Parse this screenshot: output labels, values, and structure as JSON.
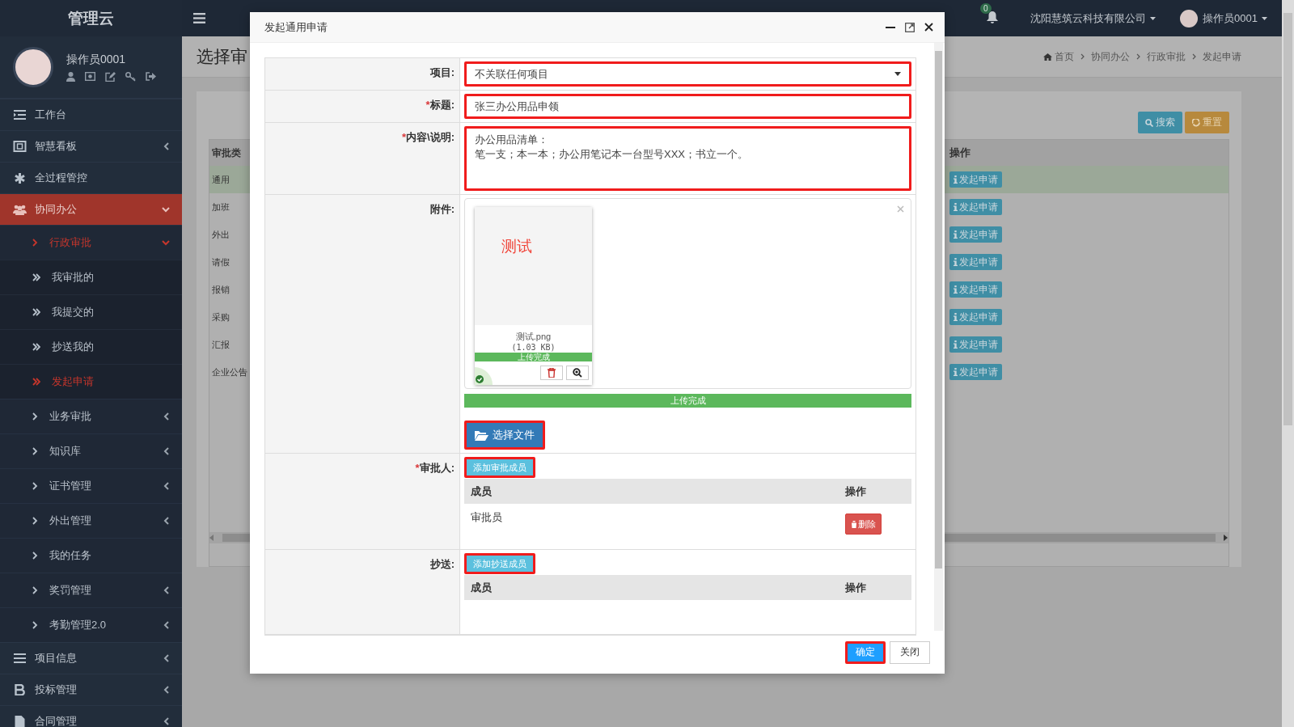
{
  "sidebar": {
    "brand": "管理云",
    "user": {
      "name": "操作员0001"
    },
    "menu": [
      {
        "label": "工作台",
        "selected": false
      },
      {
        "label": "智慧看板",
        "expanded": false,
        "selected": false
      },
      {
        "label": "全过程管控",
        "selected": false
      },
      {
        "label": "协同办公",
        "expanded": true,
        "selected": true,
        "children": [
          {
            "label": "行政审批",
            "expanded": true,
            "selected": true,
            "children": [
              {
                "label": "我审批的",
                "selected": false
              },
              {
                "label": "我提交的",
                "selected": false
              },
              {
                "label": "抄送我的",
                "selected": false
              },
              {
                "label": "发起申请",
                "selected": true
              }
            ]
          },
          {
            "label": "业务审批",
            "expanded": false,
            "selected": false
          },
          {
            "label": "知识库",
            "expanded": false,
            "selected": false
          },
          {
            "label": "证书管理",
            "expanded": false,
            "selected": false
          },
          {
            "label": "外出管理",
            "expanded": false,
            "selected": false
          },
          {
            "label": "我的任务",
            "selected": false
          },
          {
            "label": "奖罚管理",
            "expanded": false,
            "selected": false
          },
          {
            "label": "考勤管理2.0",
            "expanded": false,
            "selected": false
          }
        ]
      },
      {
        "label": "项目信息",
        "expanded": false,
        "selected": false
      },
      {
        "label": "投标管理",
        "expanded": false,
        "selected": false
      },
      {
        "label": "合同管理",
        "expanded": false,
        "selected": false
      }
    ]
  },
  "header": {
    "notification_count": "0",
    "company": "沈阳慧筑云科技有限公司",
    "user": "操作员0001"
  },
  "page": {
    "title": "选择审",
    "breadcrumb": [
      "首页",
      "协同办公",
      "行政审批",
      "发起申请"
    ],
    "buttons": [
      {
        "label": "搜索",
        "kind": "search"
      },
      {
        "label": "重置",
        "kind": "reset"
      }
    ],
    "table": {
      "columns": [
        "审批类",
        "操作"
      ],
      "rows": [
        {
          "type": "通用",
          "action": "发起申请",
          "selected": true
        },
        {
          "type": "加班",
          "action": "发起申请",
          "selected": false
        },
        {
          "type": "外出",
          "action": "发起申请",
          "selected": false
        },
        {
          "type": "请假",
          "action": "发起申请",
          "selected": false
        },
        {
          "type": "报销",
          "action": "发起申请",
          "selected": false
        },
        {
          "type": "采购",
          "action": "发起申请",
          "selected": false
        },
        {
          "type": "汇报",
          "action": "发起申请",
          "selected": false
        },
        {
          "type": "企业公告",
          "action": "发起申请",
          "selected": false
        }
      ]
    }
  },
  "dialog": {
    "title": "发起通用申请",
    "fields": [
      {
        "kind": "select",
        "label": "项目:",
        "value": "不关联任何项目",
        "highlighted": true
      },
      {
        "kind": "input",
        "label": "标题:",
        "required_mark": "*",
        "value": "张三办公用品申领",
        "highlighted": true
      },
      {
        "kind": "textarea",
        "label": "内容\\说明:",
        "required_mark": "*",
        "lines": [
          "办公用品清单：",
          "笔一支；本一本；办公用笔记本一台型号XXX；书立一个。"
        ],
        "highlighted": true
      },
      {
        "kind": "upload",
        "label": "附件:",
        "files": [
          {
            "preview": "测试",
            "name": "测试.png",
            "size": "(1.03 KB)",
            "progress_text": "上传完成",
            "level": 1
          }
        ],
        "progress_text": "上传完成",
        "level": 1,
        "button": {
          "label": "选择文件",
          "highlighted": true
        }
      },
      {
        "kind": "members",
        "label": "审批人:",
        "required_mark": "*",
        "button": {
          "label": "添加审批成员",
          "highlighted": true
        },
        "columns": [
          "成员",
          "操作"
        ],
        "rows": [
          {
            "member": "审批员",
            "action": "删除"
          }
        ]
      },
      {
        "kind": "members",
        "label": "抄送:",
        "button": {
          "label": "添加抄送成员",
          "highlighted": true
        },
        "columns": [
          "成员",
          "操作"
        ]
      }
    ],
    "buttons": [
      {
        "label": "确定",
        "kind": "primary",
        "highlighted": true
      },
      {
        "label": "关闭",
        "kind": "default",
        "highlighted": false
      }
    ]
  }
}
